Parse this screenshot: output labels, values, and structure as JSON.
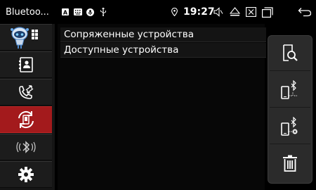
{
  "status_bar": {
    "title": "Bluetoo...",
    "clock": "19:27",
    "icons": [
      "android-a-icon",
      "keyboard-icon",
      "microphone-icon",
      "usb-icon",
      "location-icon",
      "volume-icon",
      "eject-icon",
      "screenshot-icon",
      "recent-apps-icon",
      "back-icon"
    ]
  },
  "sidebar": {
    "items": [
      {
        "name": "app-menu",
        "icon": "robot-grid-icon"
      },
      {
        "name": "contacts",
        "icon": "contacts-icon"
      },
      {
        "name": "call-log",
        "icon": "call-log-icon"
      },
      {
        "name": "pairing",
        "icon": "phone-sync-icon",
        "active": true
      },
      {
        "name": "bluetooth-audio",
        "icon": "bluetooth-wave-icon"
      },
      {
        "name": "settings",
        "icon": "gear-icon"
      }
    ]
  },
  "main": {
    "rows": [
      "Сопряженные устройства",
      "Доступные устройства"
    ]
  },
  "actions": {
    "items": [
      "search-device-icon",
      "connect-bluetooth-icon",
      "disconnect-bluetooth-icon",
      "delete-icon"
    ]
  },
  "colors": {
    "active": "#a31a1c",
    "background": "#000000",
    "panel": "#2b2b2b"
  }
}
